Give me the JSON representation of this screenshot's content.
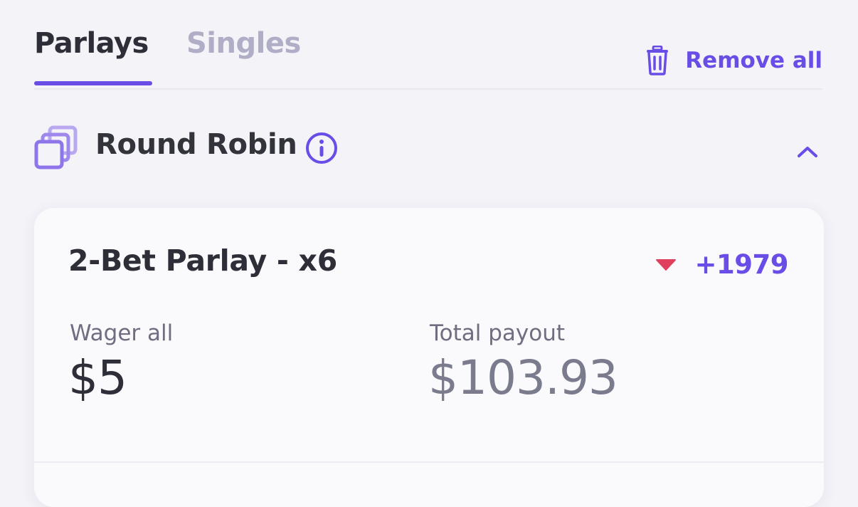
{
  "tabs": [
    {
      "label": "Parlays",
      "active": true
    },
    {
      "label": "Singles",
      "active": false
    }
  ],
  "remove_all": {
    "label": "Remove all",
    "icon": "trash-icon"
  },
  "section": {
    "title": "Round Robin",
    "icon": "round-robin-icon",
    "info_icon": "info-icon",
    "toggle_icon": "chevron-up-icon"
  },
  "parlay_card": {
    "title": "2-Bet Parlay - x6",
    "odds_trend_icon": "caret-down-icon",
    "odds": "+1979",
    "wager": {
      "label": "Wager all",
      "value": "$5"
    },
    "payout": {
      "label": "Total payout",
      "value": "$103.93"
    }
  },
  "colors": {
    "accent": "#6a4ce6",
    "accent_light": "#b9a8f0",
    "odds_down": "#e0405e",
    "background": "#f3f3f8",
    "text_primary": "#2e2e38",
    "text_muted": "#7b7b8e"
  }
}
